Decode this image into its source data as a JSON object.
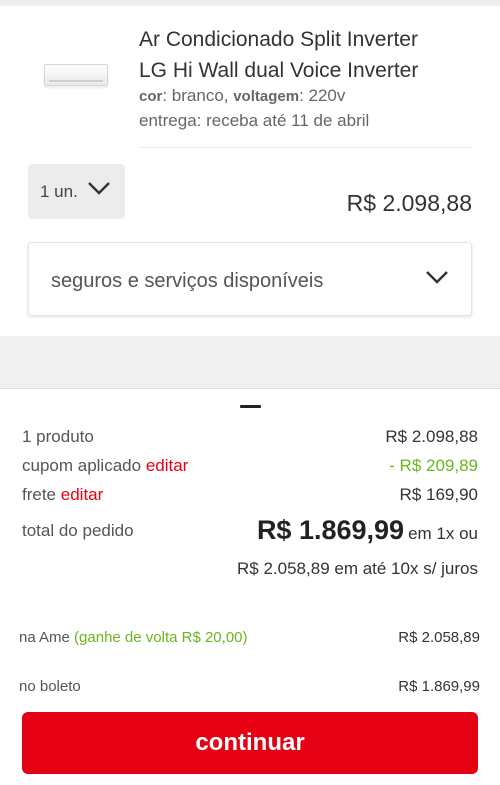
{
  "product": {
    "name": "Ar Condicionado Split Inverter LG Hi Wall dual Voice Inverter",
    "attr_cor_label": "cor",
    "attr_cor_value": ": branco, ",
    "attr_voltagem_label": "voltagem",
    "attr_voltagem_value": ": 220v",
    "delivery": "entrega: receba até 11 de abril",
    "quantity": "1 un.",
    "price": "R$ 2.098,88",
    "services_label": "seguros e serviços disponíveis"
  },
  "summary": {
    "products_label": "1 produto",
    "products_value": "R$ 2.098,88",
    "coupon_label": "cupom aplicado",
    "coupon_edit": "editar",
    "coupon_value": "- R$ 209,89",
    "shipping_label": "frete",
    "shipping_edit": "editar",
    "shipping_value": "R$ 169,90",
    "total_label": "total do pedido",
    "total_value": "R$ 1.869,99",
    "total_suffix": "em 1x ou",
    "installments": "R$ 2.058,89 em até 10x s/ juros",
    "ame_label": "na Ame",
    "ame_cashback": "(ganhe de volta R$ 20,00)",
    "ame_value": "R$ 2.058,89",
    "boleto_label": "no boleto",
    "boleto_value": "R$ 1.869,99"
  },
  "actions": {
    "continue_label": "continuar"
  },
  "colors": {
    "accent": "#e60014",
    "discount": "#6bb51f"
  },
  "icons": {
    "quantity_dropdown": "chevron-down-icon",
    "services_dropdown": "chevron-down-icon"
  }
}
